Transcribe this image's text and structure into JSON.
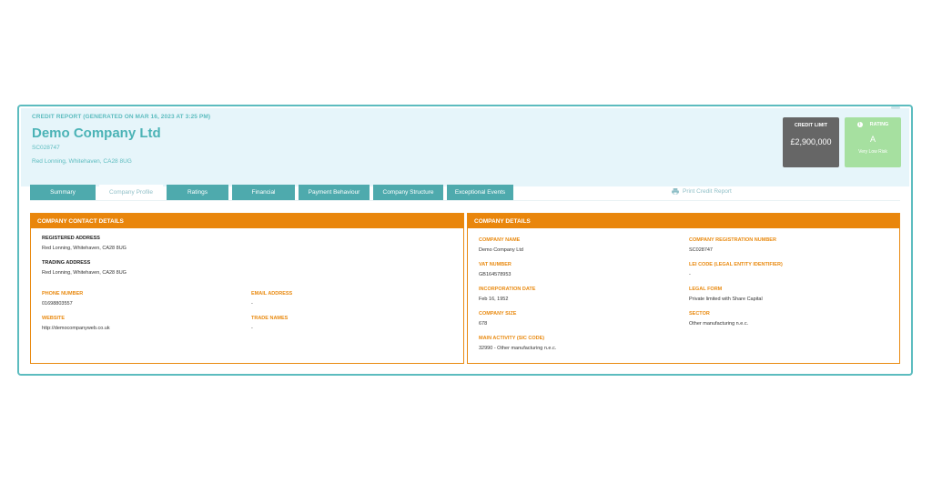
{
  "report": {
    "title": "CREDIT REPORT (GENERATED ON MAR 16, 2023 AT 3:25 PM)",
    "company_name": "Demo Company Ltd",
    "company_number": "SC028747",
    "address": "Red Lonning, Whitehaven, CA28 8UG"
  },
  "credit_limit": {
    "label": "CREDIT LIMIT",
    "value": "£2,900,000"
  },
  "rating": {
    "label": "RATING",
    "value": "A",
    "description": "Very Low Risk",
    "color": "#a6e0a0"
  },
  "tabs": [
    {
      "label": "Summary",
      "active": false
    },
    {
      "label": "Company Profile",
      "active": true
    },
    {
      "label": "Ratings",
      "active": false
    },
    {
      "label": "Financial",
      "active": false
    },
    {
      "label": "Payment Behaviour",
      "active": false
    },
    {
      "label": "Company Structure",
      "active": false
    },
    {
      "label": "Exceptional Events",
      "active": false
    }
  ],
  "print_label": "Print Credit Report",
  "contact": {
    "title": "COMPANY CONTACT DETAILS",
    "registered_address_label": "REGISTERED ADDRESS",
    "registered_address": "Red Lonning, Whitehaven, CA28 8UG",
    "trading_address_label": "TRADING ADDRESS",
    "trading_address": "Red Lonning, Whitehaven, CA28 8UG",
    "phone_label": "PHONE NUMBER",
    "phone": "01698803557",
    "email_label": "EMAIL ADDRESS",
    "email": "-",
    "website_label": "WEBSITE",
    "website": "http://democompanyweb.co.uk",
    "trade_names_label": "TRADE NAMES",
    "trade_names": "-"
  },
  "details": {
    "title": "COMPANY DETAILS",
    "name_label": "COMPANY NAME",
    "name": "Demo Company Ltd",
    "reg_label": "COMPANY REGISTRATION NUMBER",
    "reg": "SC028747",
    "vat_label": "VAT NUMBER",
    "vat": "GB164578953",
    "lei_label": "LEI CODE (LEGAL ENTITY IDENTIFIER)",
    "lei": "-",
    "inc_label": "INCORPORATION DATE",
    "inc": "Feb 16, 1952",
    "legal_label": "LEGAL FORM",
    "legal": "Private limited with Share Capital",
    "size_label": "COMPANY SIZE",
    "size": "678",
    "sector_label": "SECTOR",
    "sector": "Other manufacturing n.e.c.",
    "sic_label": "MAIN ACTIVITY (SIC CODE)",
    "sic": "32990 - Other manufacturing n.e.c."
  },
  "colors": {
    "teal": "#4eaaad",
    "orange": "#e9860c",
    "header_bg": "#e6f5fa"
  }
}
